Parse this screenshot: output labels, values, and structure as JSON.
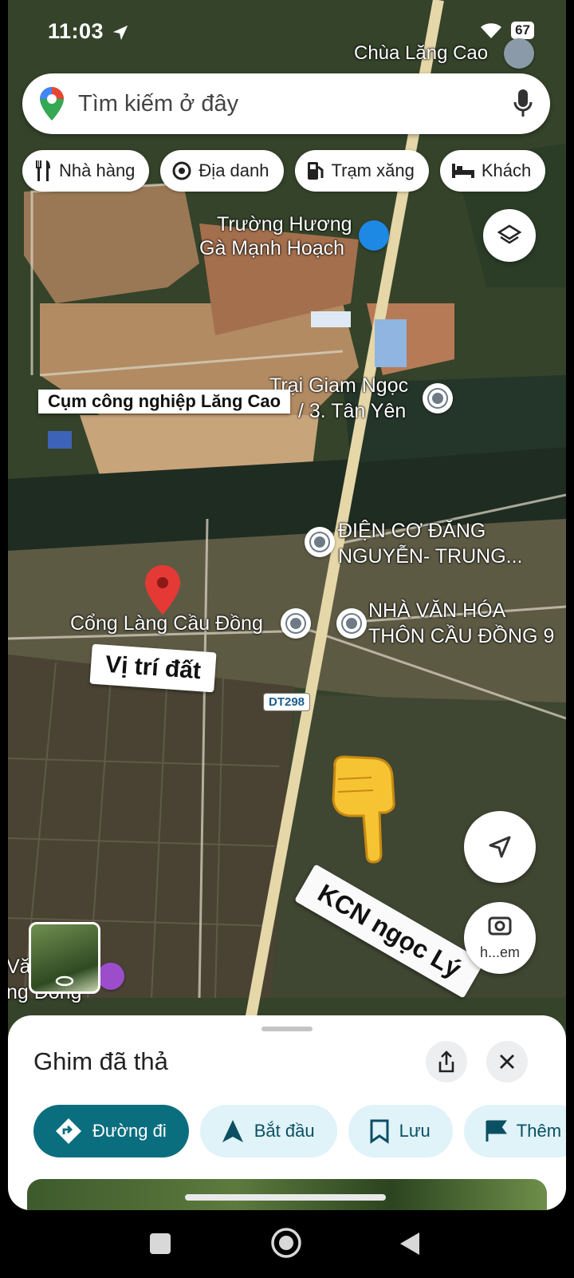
{
  "status": {
    "time": "11:03",
    "battery": "67"
  },
  "search": {
    "placeholder": "Tìm kiếm ở đây"
  },
  "chips": [
    {
      "label": "Nhà hàng",
      "icon": "fork-knife-icon"
    },
    {
      "label": "Địa danh",
      "icon": "landmark-icon"
    },
    {
      "label": "Trạm xăng",
      "icon": "gas-station-icon"
    },
    {
      "label": "Khách",
      "icon": "bed-icon"
    }
  ],
  "map": {
    "labels": {
      "chua": "Chùa Lăng Cao",
      "truong_1": "Trường Hương",
      "truong_2": "Gà Mạnh Hoạch",
      "trai_1": "Trại Giam Ngọc",
      "trai_2": "/ 3. Tân Yên",
      "dien_1": "ĐIỆN CƠ ĐĂNG",
      "dien_2": "NGUYỄN- TRUNG...",
      "nha_1": "NHÀ VĂN HÓA",
      "nha_2": "THÔN CẦU ĐỒNG 9",
      "cong": "Cổng Làng Cầu Đồng",
      "van_1": "Vă",
      "van_2": "ng Đồng",
      "road": "DT298",
      "street_view": "h...em"
    },
    "stickers": {
      "cum": "Cụm công nghiệp Lăng Cao",
      "vitri": "Vị trí đất",
      "kcn": "KCN ngọc Lý"
    }
  },
  "sheet": {
    "title": "Ghim đã thả",
    "actions": [
      {
        "label": "Đường đi",
        "icon": "directions-icon"
      },
      {
        "label": "Bắt đầu",
        "icon": "navigation-arrow-icon"
      },
      {
        "label": "Lưu",
        "icon": "bookmark-icon"
      },
      {
        "label": "Thêm",
        "icon": "flag-icon"
      }
    ]
  },
  "colors": {
    "primary": "#0b6e7f",
    "pin": "#e53935",
    "map_bg": "#3b4a2c"
  }
}
